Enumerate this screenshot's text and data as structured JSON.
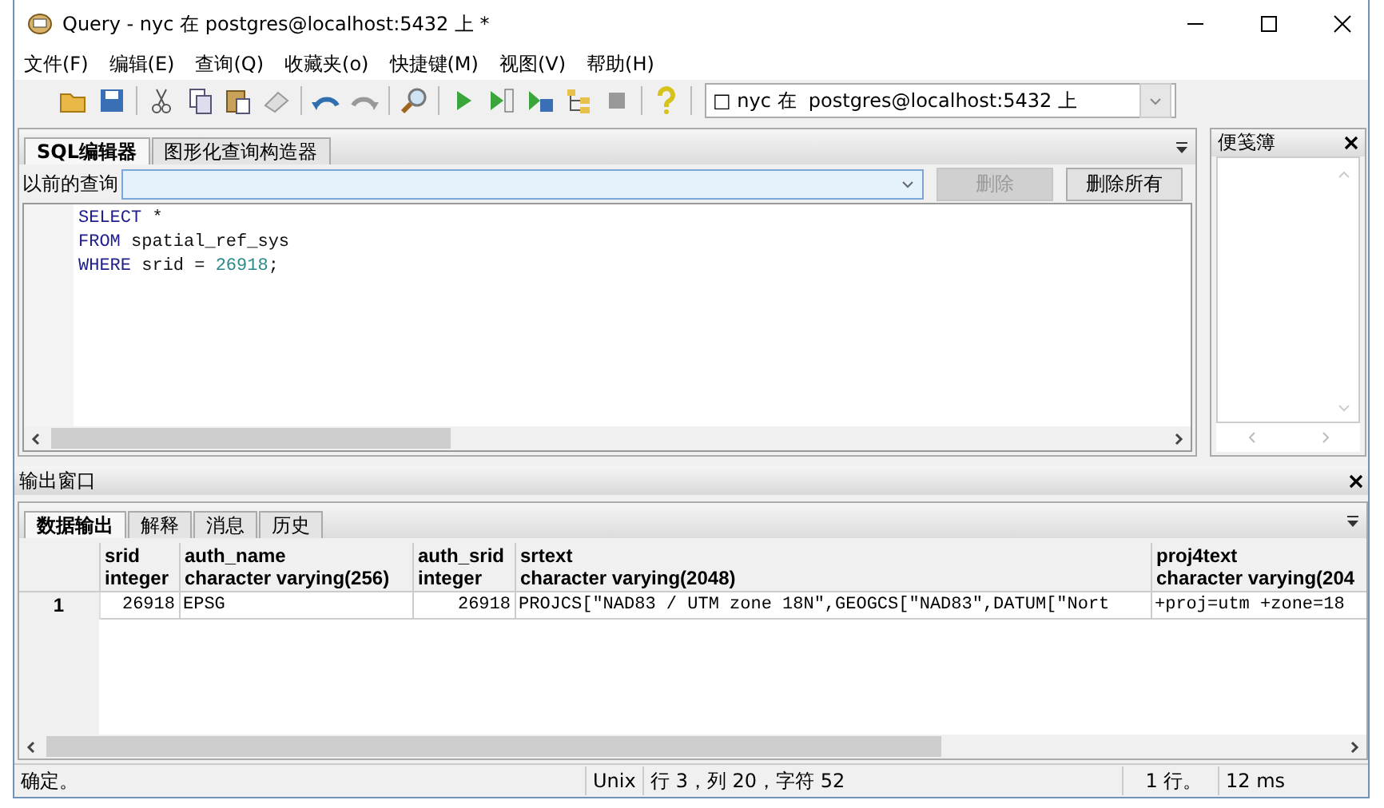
{
  "window": {
    "title": "Query - nyc 在  postgres@localhost:5432 上 *"
  },
  "menu": [
    "文件(F)",
    "编辑(E)",
    "查询(Q)",
    "收藏夹(o)",
    "快捷键(M)",
    "视图(V)",
    "帮助(H)"
  ],
  "connection": {
    "value": "□ nyc 在  postgres@localhost:5432 上"
  },
  "editor_tabs": [
    {
      "label": "SQL编辑器",
      "selected": true
    },
    {
      "label": "图形化查询构造器",
      "selected": false
    }
  ],
  "previous_query": {
    "label": "以前的查询",
    "buttons": [
      {
        "label": "删除",
        "disabled": true
      },
      {
        "label": "删除所有",
        "disabled": false
      }
    ]
  },
  "sql_lines": [
    [
      {
        "kind": "keyword",
        "text": "SELECT"
      },
      {
        "kind": "plain",
        "text": " *"
      }
    ],
    [
      {
        "kind": "keyword",
        "text": "FROM"
      },
      {
        "kind": "plain",
        "text": " spatial_ref_sys"
      }
    ],
    [
      {
        "kind": "keyword",
        "text": "WHERE"
      },
      {
        "kind": "plain",
        "text": " srid = "
      },
      {
        "kind": "number",
        "text": "26918"
      },
      {
        "kind": "plain",
        "text": ";"
      }
    ]
  ],
  "scratch_pad": {
    "title": "便笺簿"
  },
  "output": {
    "title": "输出窗口",
    "tabs": [
      {
        "label": "数据输出",
        "selected": true
      },
      {
        "label": "解释",
        "selected": false
      },
      {
        "label": "消息",
        "selected": false
      },
      {
        "label": "历史",
        "selected": false
      }
    ],
    "columns": [
      {
        "name": "srid",
        "type": "integer"
      },
      {
        "name": "auth_name",
        "type": "character varying(256)"
      },
      {
        "name": "auth_srid",
        "type": "integer"
      },
      {
        "name": "srtext",
        "type": "character varying(2048)"
      },
      {
        "name": "proj4text",
        "type": "character varying(204"
      }
    ],
    "rows": [
      {
        "index": "1",
        "cells": [
          {
            "text": "26918",
            "kind": "number"
          },
          {
            "text": "EPSG",
            "kind": "text"
          },
          {
            "text": "26918",
            "kind": "number"
          },
          {
            "text": "PROJCS[\"NAD83 / UTM zone 18N\",GEOGCS[\"NAD83\",DATUM[\"Nort",
            "kind": "text"
          },
          {
            "text": "+proj=utm +zone=18",
            "kind": "text"
          }
        ]
      }
    ]
  },
  "status_bar": {
    "message": "确定。",
    "line_ending": "Unix",
    "position": "行 3，列 20，字符 52",
    "rows": "1 行。",
    "time": "12 ms"
  }
}
